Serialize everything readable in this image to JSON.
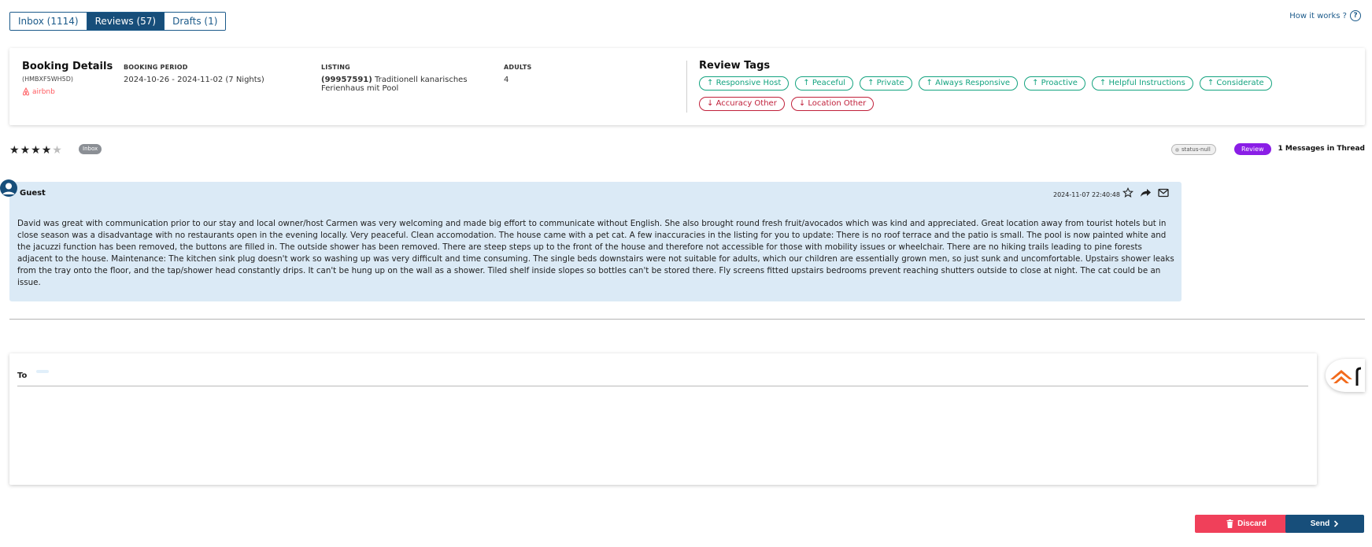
{
  "tabs": [
    {
      "label": "Inbox (1114)",
      "active": false
    },
    {
      "label": "Reviews (57)",
      "active": true
    },
    {
      "label": "Drafts (1)",
      "active": false
    }
  ],
  "help": {
    "label": "How it works ?",
    "icon": "question-circle-icon"
  },
  "booking": {
    "title": "Booking Details",
    "code": "(HMBXF5WH5D)",
    "source": "airbnb",
    "period_label": "BOOKING PERIOD",
    "period_value": "2024-10-26 - 2024-11-02 (7 Nights)",
    "listing_label": "LISTING",
    "listing_id": "(99957591)",
    "listing_name": " Traditionell kanarisches Ferienhaus mit Pool",
    "adults_label": "ADULTS",
    "adults_value": "4"
  },
  "review_tags": {
    "title": "Review Tags",
    "tags": [
      {
        "label": "Responsive Host",
        "sentiment": "positive",
        "arrow": "↑"
      },
      {
        "label": "Peaceful",
        "sentiment": "positive",
        "arrow": "↑"
      },
      {
        "label": "Private",
        "sentiment": "positive",
        "arrow": "↑"
      },
      {
        "label": "Always Responsive",
        "sentiment": "positive",
        "arrow": "↑"
      },
      {
        "label": "Proactive",
        "sentiment": "positive",
        "arrow": "↑"
      },
      {
        "label": "Helpful Instructions",
        "sentiment": "positive",
        "arrow": "↑"
      },
      {
        "label": "Considerate",
        "sentiment": "positive",
        "arrow": "↑"
      },
      {
        "label": "Accuracy Other",
        "sentiment": "negative",
        "arrow": "↓"
      },
      {
        "label": "Location Other",
        "sentiment": "negative",
        "arrow": "↓"
      }
    ]
  },
  "rating": {
    "value": 4,
    "max": 5
  },
  "status_row": {
    "source_badge": "Inbox",
    "status": "status-null",
    "type_badge": "Review",
    "thread_count": "1 Messages in Thread"
  },
  "message": {
    "sender": "Guest",
    "timestamp": "2024-11-07 22:40:48",
    "text": "David was great with communication prior to our stay and local owner/host Carmen was very welcoming and made big effort to communicate without English. She also brought round fresh fruit/avocados which was kind and appreciated. Great location away from tourist hotels but in close season was a disadvantage with no restaurants open in the evening locally. Very peaceful. Clean accomodation. The house came with a pet cat. A few inaccuracies in the listing for you to update: There is no roof terrace and the patio is small. The pool is now painted white and the jacuzzi function has been removed, the buttons are filled in. The outside shower has been removed. There are steep steps up to the front of the house and therefore not accessible for those with mobility issues or wheelchair. There are no hiking trails leading to pine forests adjacent to the house. Maintenance: The kitchen sink plug doesn't work so washing up was very difficult and time consuming. The single beds downstairs were not suitable for adults, which our children are essentially grown men, so just sunk and uncomfortable. Upstairs shower leaks from the tray onto the floor, and the tap/shower head constantly drips. It can't be hung up on the wall as a shower. Tiled shelf inside slopes so bottles can't be stored there. Fly screens fitted upstairs bedrooms prevent reaching shutters outside to close at night. The cat could be an issue."
  },
  "compose": {
    "to_label": "To"
  },
  "actions": {
    "discard": "Discard",
    "send": "Send"
  },
  "colors": {
    "primary": "#174e7a",
    "positive": "#13a37f",
    "negative": "#c0203a",
    "discard": "#f0405a",
    "review_badge": "#8a1ee6",
    "message_bg": "#dbeaf6"
  }
}
